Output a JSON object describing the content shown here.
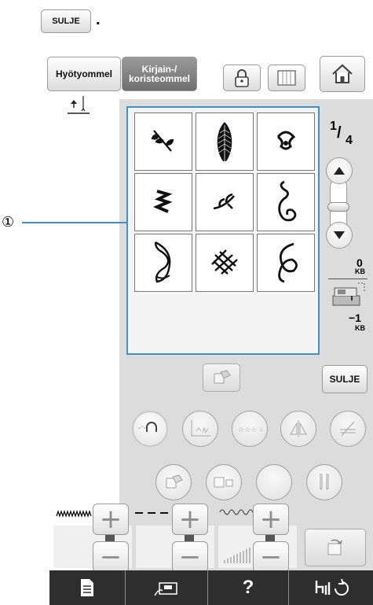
{
  "intro": {
    "button": "SULJE",
    "period": "."
  },
  "header": {
    "tab_utility": "Hyötyommel",
    "tab_character_line1": "Kirjain-/",
    "tab_character_line2": "koristeommel"
  },
  "callout": "①",
  "page": {
    "num": "1",
    "den": "4"
  },
  "memory": {
    "top_value": "0",
    "top_unit": "KB",
    "bottom_value": "−1",
    "bottom_unit": "KB"
  },
  "close_button": "SULJE",
  "bottom_tabs": {
    "help": "?"
  },
  "icons": {
    "lock": "padlock-icon",
    "sheet": "page-icon",
    "home": "home-icon",
    "scroll_up": "up-arrow-icon",
    "scroll_down": "down-arrow-icon",
    "machine": "sewing-machine-icon"
  },
  "colors": {
    "highlight": "#3d93c9",
    "panel": "#dcdcdc",
    "tabbar": "#2e2e2e"
  }
}
